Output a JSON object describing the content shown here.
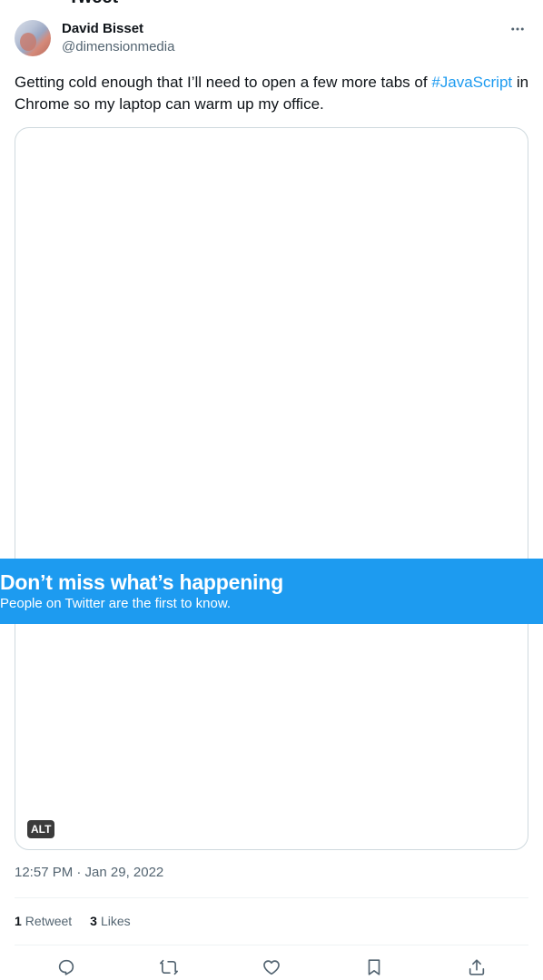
{
  "header": {
    "title_cut": "Tweet"
  },
  "author": {
    "display_name": "David Bisset",
    "handle": "@dimensionmedia"
  },
  "tweet": {
    "text_before": "Getting cold enough that I’ll need to open a few more tabs of ",
    "hashtag": "#JavaScript",
    "text_after": " in Chrome so my laptop can warm up my office.",
    "alt_badge": "ALT",
    "timestamp": "12:57 PM · Jan 29, 2022"
  },
  "stats": {
    "retweets_count": "1",
    "retweets_label": "Retweet",
    "likes_count": "3",
    "likes_label": "Likes"
  },
  "banner": {
    "title": "Don’t miss what’s happening",
    "subtitle": "People on Twitter are the first to know."
  },
  "actions": {
    "icons": [
      "reply-icon",
      "retweet-icon",
      "like-icon",
      "bookmark-icon",
      "share-icon"
    ]
  },
  "colors": {
    "accent": "#1d9bf0",
    "text_primary": "#0f1419",
    "text_secondary": "#536471",
    "border": "#cfd9de"
  }
}
